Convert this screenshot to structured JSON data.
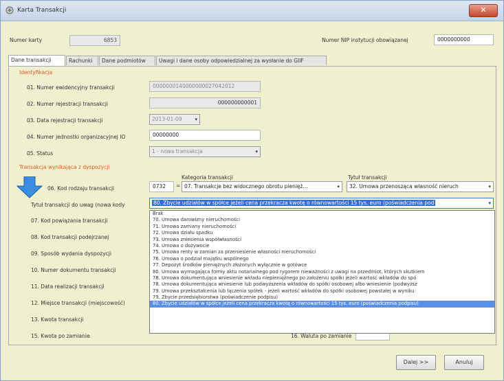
{
  "window": {
    "title": "Karta Transakcji",
    "close_label": "✕"
  },
  "header": {
    "card_number_label": "Numer karty",
    "card_number_value": "6853",
    "nip_label": "Numer NIP instytucji obowiązanej",
    "nip_value": "0000000000"
  },
  "tabs": [
    {
      "label": "Dane transakcji",
      "active": true
    },
    {
      "label": "Rachunki"
    },
    {
      "label": "Dane podmiotów"
    },
    {
      "label": "Uwagi i dane osoby odpowiedzialnej za wysłanie do GIIF"
    }
  ],
  "section_identification": "Identyfikacja",
  "section_transaction": "Transakcja wynikająca z dyspozycji",
  "fields": {
    "f01_label": "01. Numer ewidencyjny transakcji",
    "f01_value": "0000000140000000027042012",
    "f02_label": "02. Numer rejestracji transakcji",
    "f02_value": "000000000001",
    "f03_label": "03. Data rejestracji transakcji",
    "f03_value": "2013-01-09",
    "f04_label": "04. Numer jednostki organizacyjnej IO",
    "f04_value": "00000000",
    "f05_label": "05. Status",
    "f05_value": "1 - nowa transakcja",
    "f06_label": "06. Kod rodzaju transakcji",
    "f06_code": "0732",
    "category_label": "Kategoria transakcji",
    "category_value": "07. Transakcje bez widocznego obrotu pienięż...",
    "title_label": "Tytuł transakcji",
    "title_value": "32. Umowa przenosząca własność nieruch",
    "reasons_label": "Tytuł transakcji do uwag (nowa kody",
    "reasons_value": "80. Zbycie udziałów w spółce jeżeli cena przekracza kwotę o równowartości 15 tys. euro (poświadczenia pod",
    "f07_label": "07. Kod powiązania transakcji",
    "f08_label": "08. Kod transakcji podejrzanej",
    "f09_label": "09. Sposób wydania dyspozycji",
    "f10_label": "10. Numer dokumentu transakcji",
    "f11_label": "11. Data realizacji transakcji",
    "f12_label": "12. Miejsce transakcji (miejscowość)",
    "f13_label": "13. Kwota transakcji",
    "f15_label": "15. Kwota po zamianie",
    "f16_label": "16. Waluta po zamianie"
  },
  "dropdown_options": [
    "Brak",
    "70. Umowa darowizny nieruchomości",
    "71. Umowa zamiany nieruchomości",
    "72. Umowa działu spadku",
    "73. Umowa zniesienia współwłasności",
    "74. Umowa o dożywocie",
    "75. Umowa renty w zamian za przeniesienie własności nieruchomości",
    "76. Umowa o podział majątku wspólnego",
    "77. Depozyt środków pieniężnych złożonych wyłącznie w gotówce",
    "80. Umowa wymagająca formy aktu notarialnego pod rygorem nieważności z uwagi na przedmiot, których skutkiem",
    "78. Umowa dokumentująca wniesienie wkładu niepieniężnego po założeniu spółki jeżeli wartość wkładów do spó",
    "78. Umowa dokumentująca wniesienie lub podwyższenia wkładów do spółki osobowej albo wniesienie (podwyższ",
    "79. Umowa przekształcenia lub łączenia spółek - jeżeli wartość wkładów do spółki osobowej powstałej w wyniku",
    "79. Zbycie przedsiębiorstwa (poświadczenie podpisu)",
    "80. Zbycie udziałów w spółce jeżeli cena przekracza kwotę o równowartości 15 tys. euro (poświadczenia podpisu)"
  ],
  "selected_option_index": 14,
  "buttons": {
    "next": "Dalej >>",
    "cancel": "Anuluj"
  }
}
